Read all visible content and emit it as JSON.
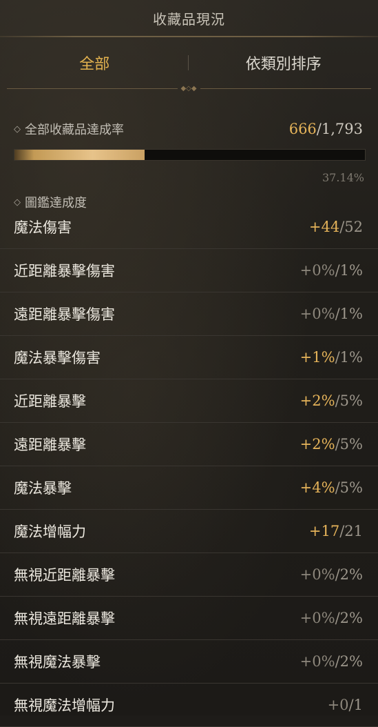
{
  "header": {
    "title": "收藏品現況"
  },
  "tabs": [
    {
      "label": "全部",
      "active": true
    },
    {
      "label": "依類別排序",
      "active": false
    }
  ],
  "overall": {
    "label": "全部收藏品達成率",
    "current": "666",
    "total": "1,793",
    "progress_fraction": 0.3714,
    "percent_text": "37.14%"
  },
  "codex": {
    "label": "圖鑑達成度"
  },
  "stats": [
    {
      "name": "魔法傷害",
      "current": "+44",
      "max": "52",
      "active": true
    },
    {
      "name": "近距離暴擊傷害",
      "current": "+0%",
      "max": "1%",
      "active": false
    },
    {
      "name": "遠距離暴擊傷害",
      "current": "+0%",
      "max": "1%",
      "active": false
    },
    {
      "name": "魔法暴擊傷害",
      "current": "+1%",
      "max": "1%",
      "active": true
    },
    {
      "name": "近距離暴擊",
      "current": "+2%",
      "max": "5%",
      "active": true
    },
    {
      "name": "遠距離暴擊",
      "current": "+2%",
      "max": "5%",
      "active": true
    },
    {
      "name": "魔法暴擊",
      "current": "+4%",
      "max": "5%",
      "active": true
    },
    {
      "name": "魔法增幅力",
      "current": "+17",
      "max": "21",
      "active": true
    },
    {
      "name": "無視近距離暴擊",
      "current": "+0%",
      "max": "2%",
      "active": false
    },
    {
      "name": "無視遠距離暴擊",
      "current": "+0%",
      "max": "2%",
      "active": false
    },
    {
      "name": "無視魔法暴擊",
      "current": "+0%",
      "max": "2%",
      "active": false
    },
    {
      "name": "無視魔法增幅力",
      "current": "+0",
      "max": "1",
      "active": false
    }
  ],
  "colors": {
    "accent": "#e6b45a",
    "inactive_value": "#8d877c",
    "background": "#1e1c19"
  },
  "icons": {
    "section_marker": "diamond-icon",
    "tab_ornament": "ornament-icon"
  }
}
